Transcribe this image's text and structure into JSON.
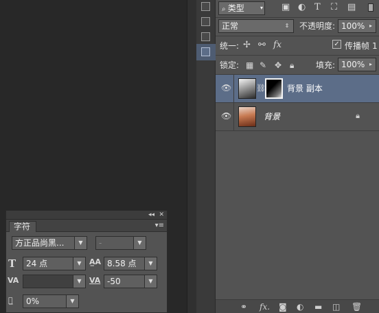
{
  "layers_panel": {
    "filter_label": "类型",
    "filter_prefix_icon": "search-icon",
    "blend_mode": "正常",
    "opacity_label": "不透明度:",
    "opacity_value": "100%",
    "unify_label": "统一:",
    "propagate_label": "传播帧",
    "propagate_value": "1",
    "lock_label": "锁定:",
    "fill_label": "填充:",
    "fill_value": "100%",
    "layers": [
      {
        "name": "背景 副本",
        "selected": true,
        "has_mask": true
      },
      {
        "name": "背景",
        "selected": false,
        "locked": true
      }
    ]
  },
  "character_panel": {
    "tab_label": "字符",
    "font_family": "方正品尚黑...",
    "font_style": "-",
    "font_size": "24 点",
    "leading": "8.58 点",
    "kerning": "",
    "tracking": "-50",
    "vertical_scale": "0%"
  },
  "icons": {
    "eye": "eye-icon",
    "link": "link-icon",
    "lock": "lock-icon"
  }
}
